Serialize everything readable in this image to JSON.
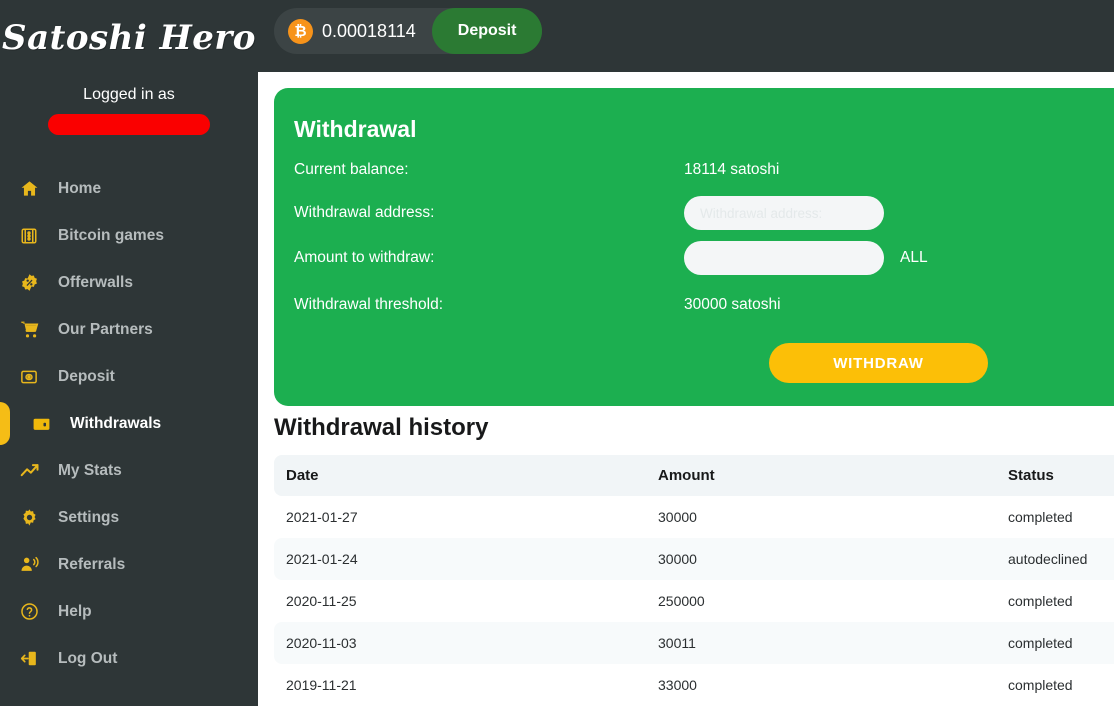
{
  "brand": {
    "name": "Satoshi Hero"
  },
  "sidebar": {
    "logged_in_label": "Logged in as",
    "username_redacted": "",
    "items": [
      {
        "label": "Home",
        "icon": "home-icon",
        "active": false
      },
      {
        "label": "Bitcoin games",
        "icon": "games-icon",
        "active": false
      },
      {
        "label": "Offerwalls",
        "icon": "percent-badge-icon",
        "active": false
      },
      {
        "label": "Our Partners",
        "icon": "cart-icon",
        "active": false
      },
      {
        "label": "Deposit",
        "icon": "deposit-icon",
        "active": false
      },
      {
        "label": "Withdrawals",
        "icon": "wallet-icon",
        "active": true
      },
      {
        "label": "My Stats",
        "icon": "trending-up-icon",
        "active": false
      },
      {
        "label": "Settings",
        "icon": "gear-icon",
        "active": false
      },
      {
        "label": "Referrals",
        "icon": "referral-icon",
        "active": false
      },
      {
        "label": "Help",
        "icon": "question-circle-icon",
        "active": false
      },
      {
        "label": "Log Out",
        "icon": "logout-icon",
        "active": false
      }
    ]
  },
  "topbar": {
    "btc_symbol": "₿",
    "balance": "0.00018114",
    "deposit_label": "Deposit"
  },
  "withdrawal": {
    "title": "Withdrawal",
    "current_balance_label": "Current balance:",
    "current_balance_value": "18114 satoshi",
    "address_label": "Withdrawal address:",
    "address_placeholder": "Withdrawal address:",
    "address_value": "",
    "amount_label": "Amount to withdraw:",
    "amount_placeholder": "",
    "amount_value": "",
    "all_label": "ALL",
    "threshold_label": "Withdrawal threshold:",
    "threshold_value": "30000 satoshi",
    "withdraw_button_label": "WITHDRAW"
  },
  "history": {
    "title": "Withdrawal history",
    "columns": [
      "Date",
      "Amount",
      "Status"
    ],
    "rows": [
      {
        "date": "2021-01-27",
        "amount": "30000",
        "status": "completed"
      },
      {
        "date": "2021-01-24",
        "amount": "30000",
        "status": "autodeclined"
      },
      {
        "date": "2020-11-25",
        "amount": "250000",
        "status": "completed"
      },
      {
        "date": "2020-11-03",
        "amount": "30011",
        "status": "completed"
      },
      {
        "date": "2019-11-21",
        "amount": "33000",
        "status": "completed"
      }
    ]
  },
  "colors": {
    "sidebar_bg": "#2e3637",
    "accent_yellow": "#e8b71c",
    "card_green": "#1caf50",
    "deposit_green": "#2b7a33",
    "withdraw_yellow": "#fcbf07",
    "btc_orange": "#f7931a",
    "redaction_red": "#fa0000"
  }
}
